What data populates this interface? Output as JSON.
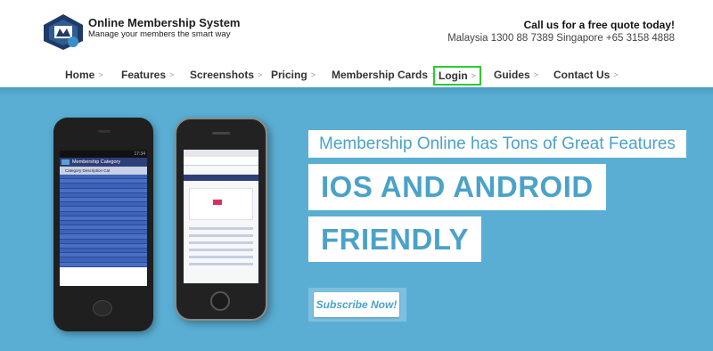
{
  "brand": {
    "title": "Online Membership System",
    "tagline": "Manage your members the smart way"
  },
  "contact": {
    "call": "Call us for a free quote today!",
    "phones": "Malaysia 1300 88 7389 Singapore +65 3158 4888"
  },
  "nav": {
    "chevron": ">",
    "items": [
      {
        "label": "Home"
      },
      {
        "label": "Features"
      },
      {
        "label": "Screenshots"
      },
      {
        "label": "Pricing"
      },
      {
        "label": "Membership Cards"
      },
      {
        "label": "Login",
        "active": true
      },
      {
        "label": "Guides"
      },
      {
        "label": "Contact Us"
      }
    ]
  },
  "hero": {
    "tagline": "Membership Online has Tons of Great Features",
    "headline_line1": "IOS AND ANDROID",
    "headline_line2": "FRIENDLY",
    "subscribe_label": "Subscribe Now!"
  },
  "phone_android": {
    "time": "17:34",
    "screen_title": "Membership Category",
    "columns": "Category   Description   Cat"
  },
  "colors": {
    "hero_bg": "#5aaed3",
    "accent_text": "#4aa2c9",
    "active_outline": "#2ecc2e",
    "logo_dark": "#1f3a66"
  }
}
